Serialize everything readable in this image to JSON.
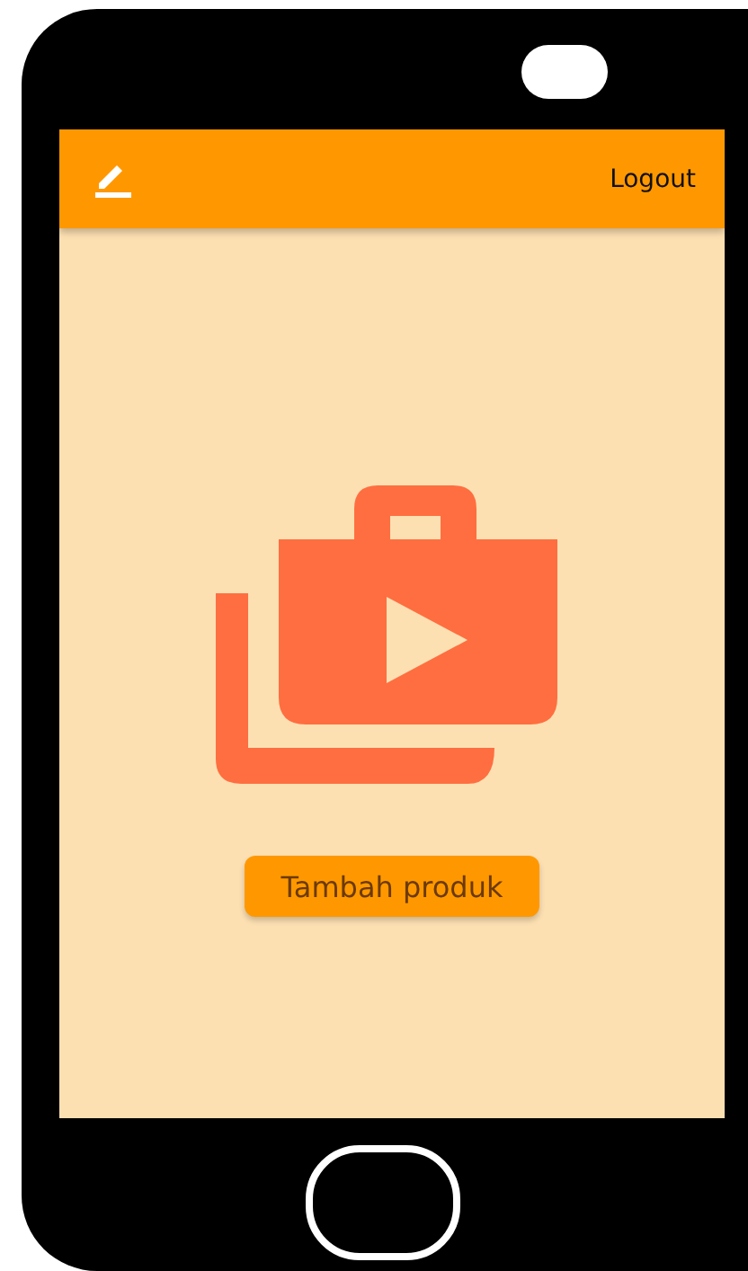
{
  "app_bar": {
    "logout": "Logout"
  },
  "content": {
    "button": "Tambah produk"
  }
}
